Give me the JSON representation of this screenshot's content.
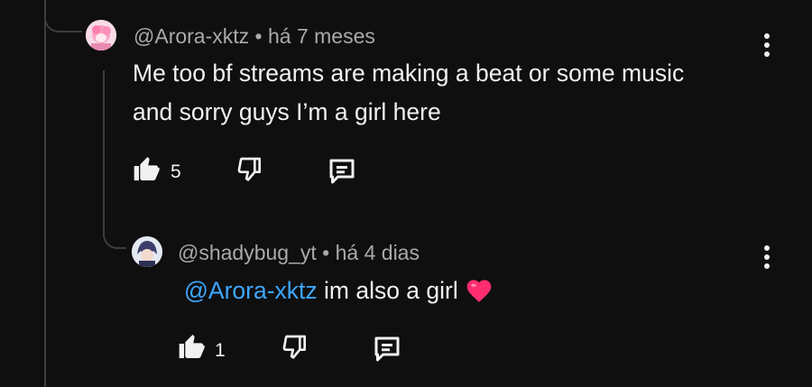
{
  "parent_comment": {
    "author": "@Arora-xktz",
    "separator": "•",
    "time": "há 7 meses",
    "text_line1": "Me too bf streams are making a beat or some music",
    "text_line2": "and sorry guys I’m a girl here",
    "like_count": "5",
    "icons": {
      "like": "thumbs-up-icon",
      "dislike": "thumbs-down-icon",
      "reply": "reply-icon",
      "menu": "more-vert-icon"
    }
  },
  "reply_comment": {
    "author": "@shadybug_yt",
    "separator": "•",
    "time": "há 4 dias",
    "mention": "@Arora-xktz",
    "text": " im also a girl ",
    "emoji": "heart-emoji",
    "like_count": "1",
    "icons": {
      "like": "thumbs-up-icon",
      "dislike": "thumbs-down-icon",
      "reply": "reply-icon",
      "menu": "more-vert-icon"
    }
  },
  "colors": {
    "background": "#0f0f0f",
    "text": "#f1f1f1",
    "meta": "#aaaaaa",
    "mention": "#3ea6ff",
    "heart": "#ff2d6f",
    "thread_line": "#3d3d3d"
  }
}
